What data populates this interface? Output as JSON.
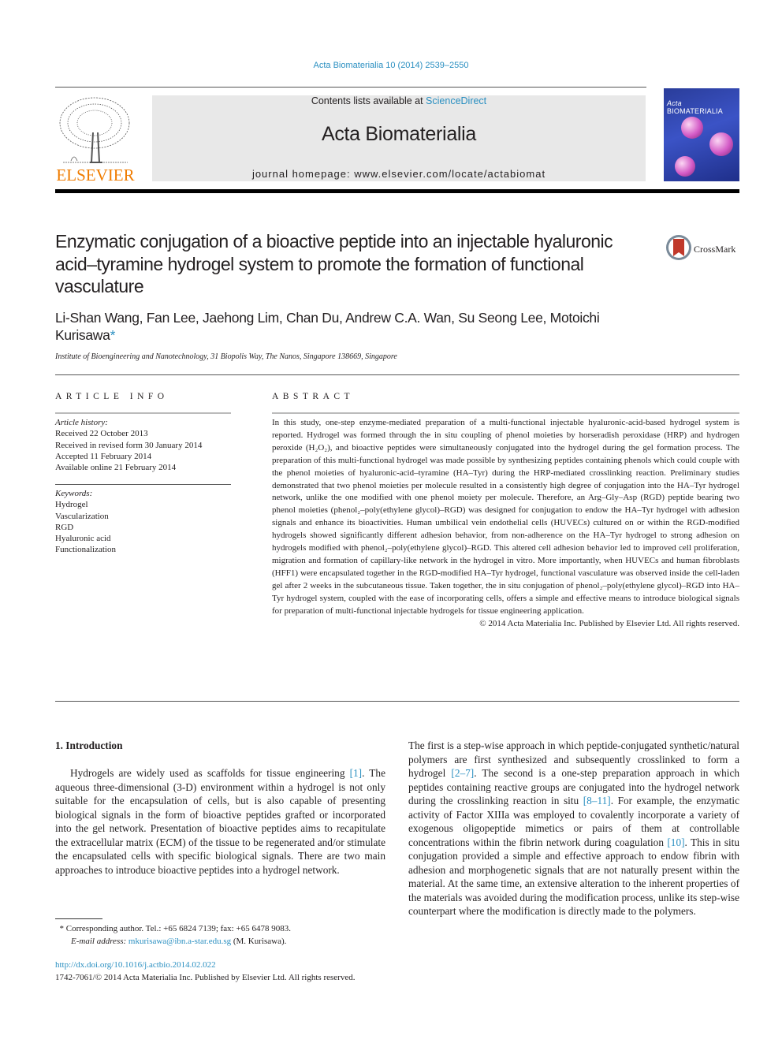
{
  "header": {
    "journal_ref": "Acta Biomaterialia 10 (2014) 2539–2550",
    "contents_prefix": "Contents lists available at ",
    "contents_link": "ScienceDirect",
    "journal_name": "Acta Biomaterialia",
    "homepage_label": "journal homepage: www.elsevier.com/locate/actabiomat",
    "publisher_logo_text": "ELSEVIER",
    "cover_title_italic": "Acta",
    "cover_title": "BIOMATERIALIA",
    "brand_colors": {
      "link": "#2a8fc1",
      "elsevier_orange": "#f07c00"
    }
  },
  "article": {
    "title": "Enzymatic conjugation of a bioactive peptide into an injectable hyaluronic acid–tyramine hydrogel system to promote the formation of functional vasculature",
    "crossmark_label": "CrossMark",
    "authors": "Li-Shan Wang, Fan Lee, Jaehong Lim, Chan Du, Andrew C.A. Wan, Su Seong Lee, Motoichi Kurisawa",
    "corresponding_mark": "*",
    "affiliation": "Institute of Bioengineering and Nanotechnology, 31 Biopolis Way, The Nanos, Singapore 138669, Singapore"
  },
  "article_info": {
    "heading": "ARTICLE INFO",
    "history_label": "Article history:",
    "history": [
      "Received 22 October 2013",
      "Received in revised form 30 January 2014",
      "Accepted 11 February 2014",
      "Available online 21 February 2014"
    ],
    "keywords_label": "Keywords:",
    "keywords": [
      "Hydrogel",
      "Vascularization",
      "RGD",
      "Hyaluronic acid",
      "Functionalization"
    ]
  },
  "abstract": {
    "heading": "ABSTRACT",
    "text": "In this study, one-step enzyme-mediated preparation of a multi-functional injectable hyaluronic-acid-based hydrogel system is reported. Hydrogel was formed through the in situ coupling of phenol moieties by horseradish peroxidase (HRP) and hydrogen peroxide (H₂O₂), and bioactive peptides were simultaneously conjugated into the hydrogel during the gel formation process. The preparation of this multi-functional hydrogel was made possible by synthesizing peptides containing phenols which could couple with the phenol moieties of hyaluronic-acid–tyramine (HA–Tyr) during the HRP-mediated crosslinking reaction. Preliminary studies demonstrated that two phenol moieties per molecule resulted in a consistently high degree of conjugation into the HA–Tyr hydrogel network, unlike the one modified with one phenol moiety per molecule. Therefore, an Arg–Gly–Asp (RGD) peptide bearing two phenol moieties (phenol₂–poly(ethylene glycol)–RGD) was designed for conjugation to endow the HA–Tyr hydrogel with adhesion signals and enhance its bioactivities. Human umbilical vein endothelial cells (HUVECs) cultured on or within the RGD-modified hydrogels showed significantly different adhesion behavior, from non-adherence on the HA–Tyr hydrogel to strong adhesion on hydrogels modified with phenol₂–poly(ethylene glycol)–RGD. This altered cell adhesion behavior led to improved cell proliferation, migration and formation of capillary-like network in the hydrogel in vitro. More importantly, when HUVECs and human fibroblasts (HFF1) were encapsulated together in the RGD-modified HA–Tyr hydrogel, functional vasculature was observed inside the cell-laden gel after 2 weeks in the subcutaneous tissue. Taken together, the in situ conjugation of phenol₂–poly(ethylene glycol)–RGD into HA–Tyr hydrogel system, coupled with the ease of incorporating cells, offers a simple and effective means to introduce biological signals for preparation of multi-functional injectable hydrogels for tissue engineering application.",
    "copyright": "© 2014 Acta Materialia Inc. Published by Elsevier Ltd. All rights reserved."
  },
  "body": {
    "section_heading": "1. Introduction",
    "left_p1": "Hydrogels are widely used as scaffolds for tissue engineering ",
    "left_ref1": "[1]",
    "left_p2": ". The aqueous three-dimensional (3-D) environment within a hydrogel is not only suitable for the encapsulation of cells, but is also capable of presenting biological signals in the form of bioactive peptides grafted or incorporated into the gel network. Presentation of bioactive peptides aims to recapitulate the extracellular matrix (ECM) of the tissue to be regenerated and/or stimulate the encapsulated cells with specific biological signals. There are two main approaches to introduce bioactive peptides into a hydrogel network.",
    "right_p1": "The first is a step-wise approach in which peptide-conjugated synthetic/natural polymers are first synthesized and subsequently crosslinked to form a hydrogel ",
    "right_ref1": "[2–7]",
    "right_p2": ". The second is a one-step preparation approach in which peptides containing reactive groups are conjugated into the hydrogel network during the crosslinking reaction in situ ",
    "right_ref2": "[8–11]",
    "right_p3": ". For example, the enzymatic activity of Factor XIIIa was employed to covalently incorporate a variety of exogenous oligopeptide mimetics or pairs of them at controllable concentrations within the fibrin network during coagulation ",
    "right_ref3": "[10]",
    "right_p4": ". This in situ conjugation provided a simple and effective approach to endow fibrin with adhesion and morphogenetic signals that are not naturally present within the material. At the same time, an extensive alteration to the inherent properties of the materials was avoided during the modification process, unlike its step-wise counterpart where the modification is directly made to the polymers."
  },
  "footnote": {
    "mark": "*",
    "text": " Corresponding author. Tel.: +65 6824 7139; fax: +65 6478 9083.",
    "email_label": "E-mail address: ",
    "email": "mkurisawa@ibn.a-star.edu.sg",
    "email_suffix": " (M. Kurisawa)."
  },
  "footer": {
    "doi": "http://dx.doi.org/10.1016/j.actbio.2014.02.022",
    "issn_line": "1742-7061/© 2014 Acta Materialia Inc. Published by Elsevier Ltd. All rights reserved."
  }
}
